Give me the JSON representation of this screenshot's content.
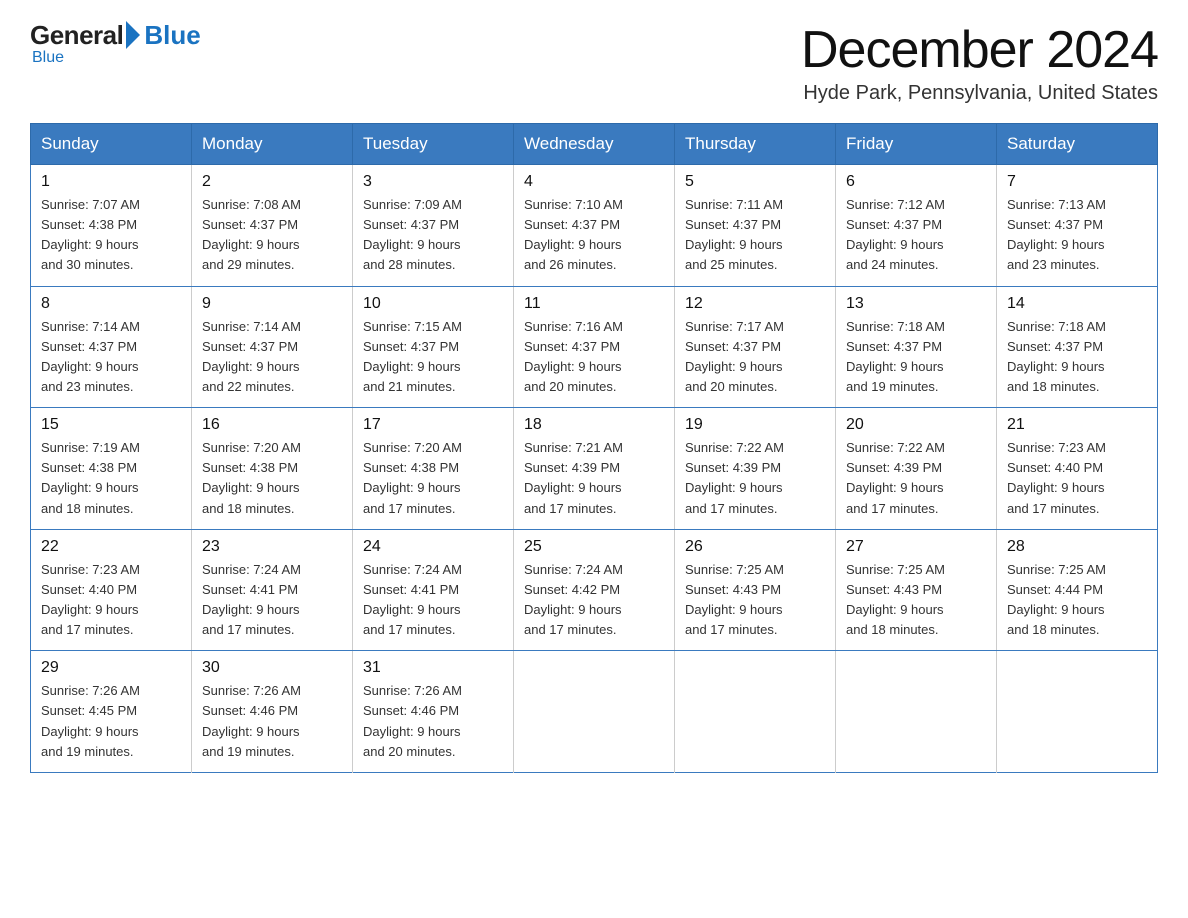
{
  "logo": {
    "general": "General",
    "blue": "Blue",
    "subtitle": "Blue"
  },
  "header": {
    "month_year": "December 2024",
    "location": "Hyde Park, Pennsylvania, United States"
  },
  "weekdays": [
    "Sunday",
    "Monday",
    "Tuesday",
    "Wednesday",
    "Thursday",
    "Friday",
    "Saturday"
  ],
  "weeks": [
    [
      {
        "day": "1",
        "sunrise": "7:07 AM",
        "sunset": "4:38 PM",
        "daylight": "9 hours and 30 minutes."
      },
      {
        "day": "2",
        "sunrise": "7:08 AM",
        "sunset": "4:37 PM",
        "daylight": "9 hours and 29 minutes."
      },
      {
        "day": "3",
        "sunrise": "7:09 AM",
        "sunset": "4:37 PM",
        "daylight": "9 hours and 28 minutes."
      },
      {
        "day": "4",
        "sunrise": "7:10 AM",
        "sunset": "4:37 PM",
        "daylight": "9 hours and 26 minutes."
      },
      {
        "day": "5",
        "sunrise": "7:11 AM",
        "sunset": "4:37 PM",
        "daylight": "9 hours and 25 minutes."
      },
      {
        "day": "6",
        "sunrise": "7:12 AM",
        "sunset": "4:37 PM",
        "daylight": "9 hours and 24 minutes."
      },
      {
        "day": "7",
        "sunrise": "7:13 AM",
        "sunset": "4:37 PM",
        "daylight": "9 hours and 23 minutes."
      }
    ],
    [
      {
        "day": "8",
        "sunrise": "7:14 AM",
        "sunset": "4:37 PM",
        "daylight": "9 hours and 23 minutes."
      },
      {
        "day": "9",
        "sunrise": "7:14 AM",
        "sunset": "4:37 PM",
        "daylight": "9 hours and 22 minutes."
      },
      {
        "day": "10",
        "sunrise": "7:15 AM",
        "sunset": "4:37 PM",
        "daylight": "9 hours and 21 minutes."
      },
      {
        "day": "11",
        "sunrise": "7:16 AM",
        "sunset": "4:37 PM",
        "daylight": "9 hours and 20 minutes."
      },
      {
        "day": "12",
        "sunrise": "7:17 AM",
        "sunset": "4:37 PM",
        "daylight": "9 hours and 20 minutes."
      },
      {
        "day": "13",
        "sunrise": "7:18 AM",
        "sunset": "4:37 PM",
        "daylight": "9 hours and 19 minutes."
      },
      {
        "day": "14",
        "sunrise": "7:18 AM",
        "sunset": "4:37 PM",
        "daylight": "9 hours and 18 minutes."
      }
    ],
    [
      {
        "day": "15",
        "sunrise": "7:19 AM",
        "sunset": "4:38 PM",
        "daylight": "9 hours and 18 minutes."
      },
      {
        "day": "16",
        "sunrise": "7:20 AM",
        "sunset": "4:38 PM",
        "daylight": "9 hours and 18 minutes."
      },
      {
        "day": "17",
        "sunrise": "7:20 AM",
        "sunset": "4:38 PM",
        "daylight": "9 hours and 17 minutes."
      },
      {
        "day": "18",
        "sunrise": "7:21 AM",
        "sunset": "4:39 PM",
        "daylight": "9 hours and 17 minutes."
      },
      {
        "day": "19",
        "sunrise": "7:22 AM",
        "sunset": "4:39 PM",
        "daylight": "9 hours and 17 minutes."
      },
      {
        "day": "20",
        "sunrise": "7:22 AM",
        "sunset": "4:39 PM",
        "daylight": "9 hours and 17 minutes."
      },
      {
        "day": "21",
        "sunrise": "7:23 AM",
        "sunset": "4:40 PM",
        "daylight": "9 hours and 17 minutes."
      }
    ],
    [
      {
        "day": "22",
        "sunrise": "7:23 AM",
        "sunset": "4:40 PM",
        "daylight": "9 hours and 17 minutes."
      },
      {
        "day": "23",
        "sunrise": "7:24 AM",
        "sunset": "4:41 PM",
        "daylight": "9 hours and 17 minutes."
      },
      {
        "day": "24",
        "sunrise": "7:24 AM",
        "sunset": "4:41 PM",
        "daylight": "9 hours and 17 minutes."
      },
      {
        "day": "25",
        "sunrise": "7:24 AM",
        "sunset": "4:42 PM",
        "daylight": "9 hours and 17 minutes."
      },
      {
        "day": "26",
        "sunrise": "7:25 AM",
        "sunset": "4:43 PM",
        "daylight": "9 hours and 17 minutes."
      },
      {
        "day": "27",
        "sunrise": "7:25 AM",
        "sunset": "4:43 PM",
        "daylight": "9 hours and 18 minutes."
      },
      {
        "day": "28",
        "sunrise": "7:25 AM",
        "sunset": "4:44 PM",
        "daylight": "9 hours and 18 minutes."
      }
    ],
    [
      {
        "day": "29",
        "sunrise": "7:26 AM",
        "sunset": "4:45 PM",
        "daylight": "9 hours and 19 minutes."
      },
      {
        "day": "30",
        "sunrise": "7:26 AM",
        "sunset": "4:46 PM",
        "daylight": "9 hours and 19 minutes."
      },
      {
        "day": "31",
        "sunrise": "7:26 AM",
        "sunset": "4:46 PM",
        "daylight": "9 hours and 20 minutes."
      },
      null,
      null,
      null,
      null
    ]
  ],
  "labels": {
    "sunrise": "Sunrise:",
    "sunset": "Sunset:",
    "daylight": "Daylight:"
  }
}
